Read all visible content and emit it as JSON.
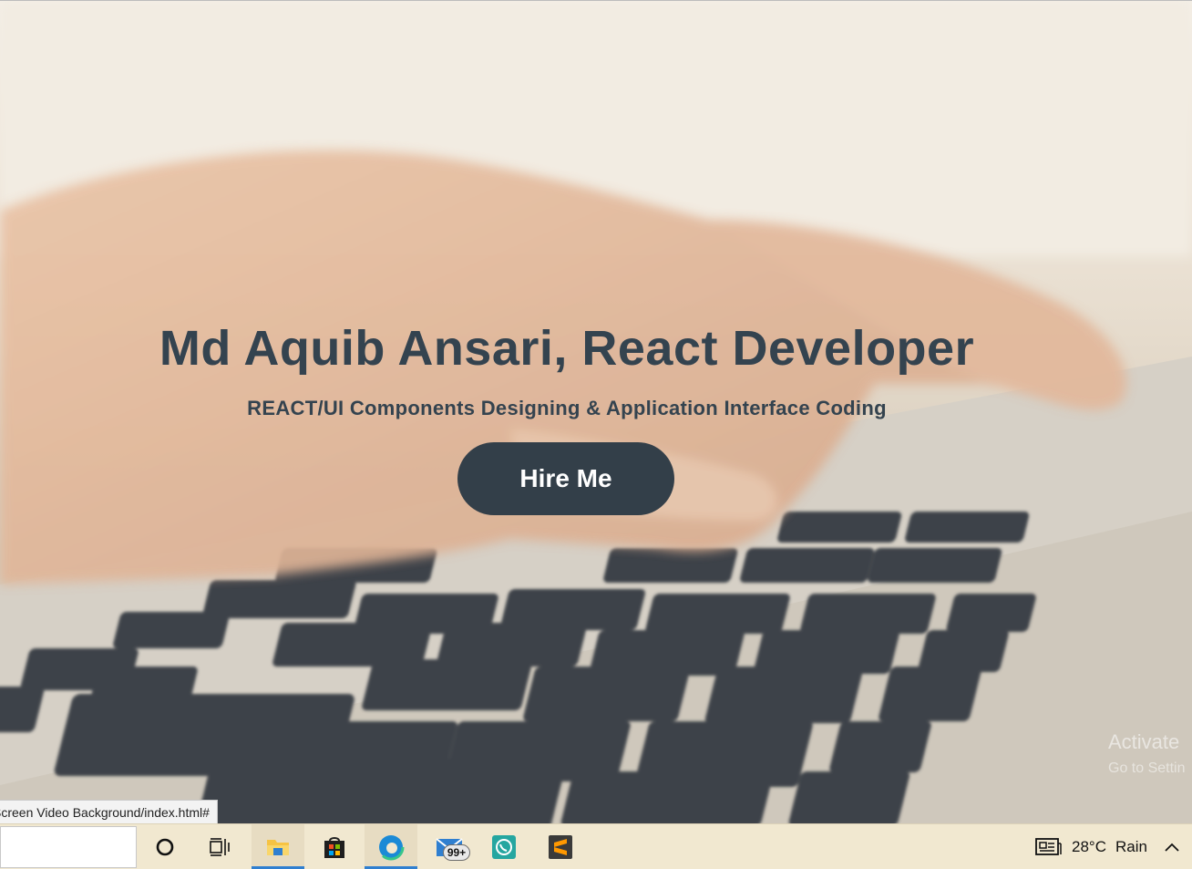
{
  "hero": {
    "title": "Md Aquib Ansari, React Developer",
    "subtitle": "REACT/UI Components Designing & Application Interface Coding",
    "cta_label": "Hire Me"
  },
  "status_bar": {
    "url": "Screen Video Background/index.html#"
  },
  "watermark": {
    "line1": "Activate",
    "line2": "Go to Settin"
  },
  "taskbar": {
    "mail_badge": "99+",
    "weather": "28°C",
    "weather_condition": "Rain"
  },
  "colors": {
    "heading": "#34434f",
    "button_bg": "#333f49",
    "button_text": "#ffffff",
    "taskbar_bg": "#f1e8d0",
    "taskbar_active_underline": "#2f7fd0"
  },
  "icons": {
    "cortana": "circle-icon",
    "task_view": "task-view-icon",
    "explorer": "file-explorer-icon",
    "store": "store-icon",
    "edge": "edge-icon",
    "mail": "mail-icon",
    "whatsapp": "whatsapp-icon",
    "sublime": "sublime-text-icon",
    "news": "news-icon",
    "tray_chevron": "chevron-up-icon"
  }
}
